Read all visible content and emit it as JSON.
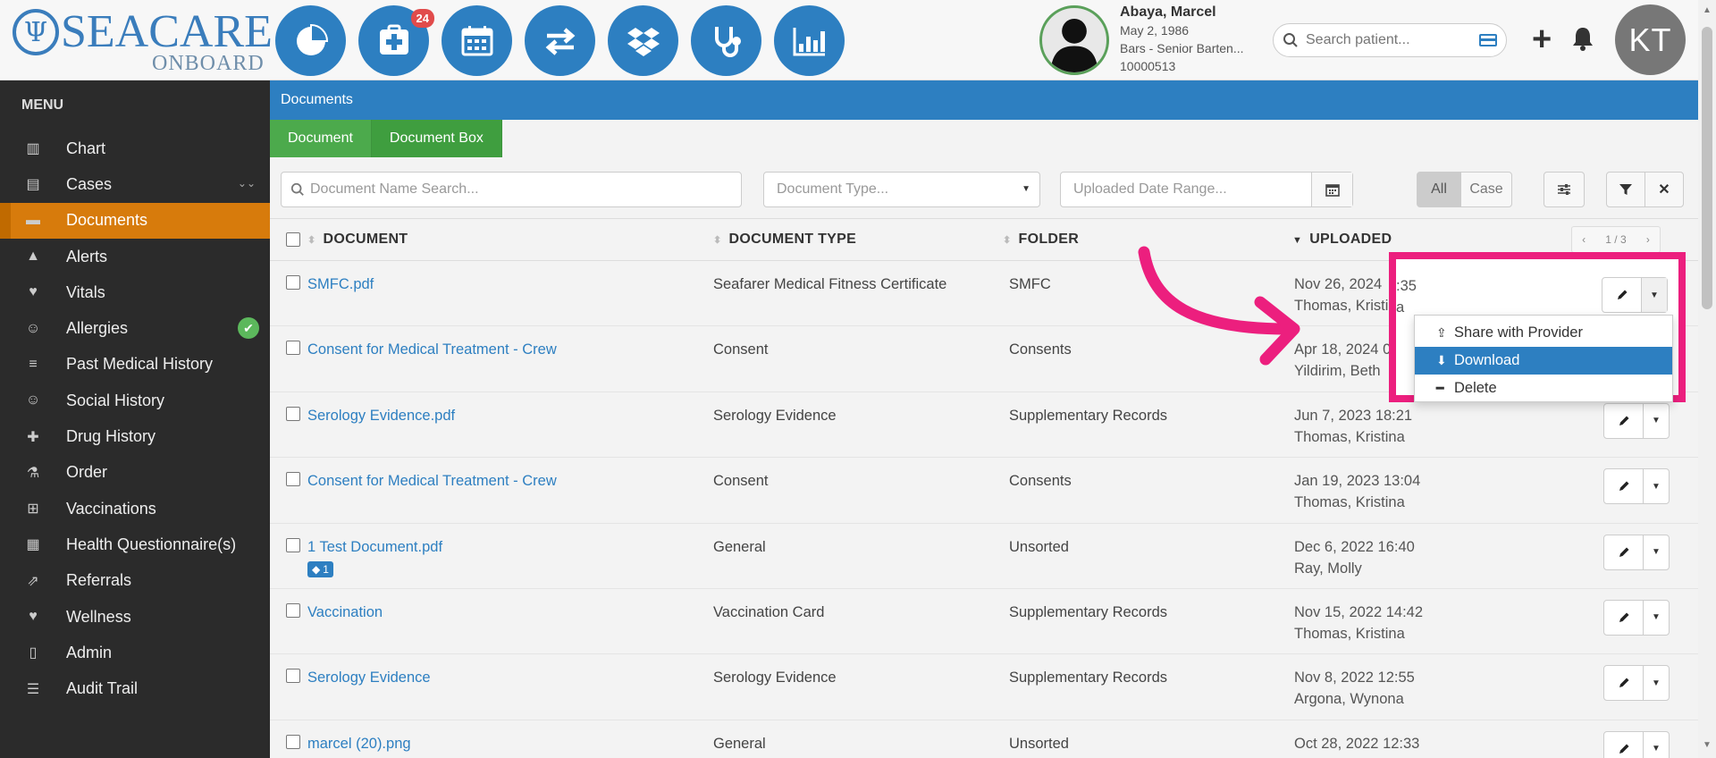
{
  "brand": {
    "name": "SEACARE",
    "sub": "ONBOARD"
  },
  "header": {
    "nav_badge": "24",
    "patient": {
      "name": "Abaya, Marcel",
      "dob": "May 2, 1986",
      "role": "Bars - Senior Barten...",
      "id": "10000513"
    },
    "search_placeholder": "Search patient...",
    "user_initials": "KT"
  },
  "sidebar": {
    "title": "MENU",
    "items": [
      {
        "label": "Chart",
        "icon": "bar-chart-icon"
      },
      {
        "label": "Cases",
        "icon": "archive-icon"
      },
      {
        "label": "Documents",
        "icon": "folder-icon"
      },
      {
        "label": "Alerts",
        "icon": "warning-icon"
      },
      {
        "label": "Vitals",
        "icon": "heart-icon"
      },
      {
        "label": "Allergies",
        "icon": "smile-icon"
      },
      {
        "label": "Past Medical History",
        "icon": "sort-icon"
      },
      {
        "label": "Social History",
        "icon": "smile-icon"
      },
      {
        "label": "Drug History",
        "icon": "medkit-icon"
      },
      {
        "label": "Order",
        "icon": "flask-icon"
      },
      {
        "label": "Vaccinations",
        "icon": "plus-square-icon"
      },
      {
        "label": "Health Questionnaire(s)",
        "icon": "form-icon"
      },
      {
        "label": "Referrals",
        "icon": "share-square-icon"
      },
      {
        "label": "Wellness",
        "icon": "heartbeat-icon"
      },
      {
        "label": "Admin",
        "icon": "file-icon"
      },
      {
        "label": "Audit Trail",
        "icon": "list-sort-icon"
      }
    ]
  },
  "page": {
    "title": "Documents",
    "tabs": [
      "Document",
      "Document Box"
    ],
    "filters": {
      "name_placeholder": "Document Name Search...",
      "type_placeholder": "Document Type...",
      "date_placeholder": "Uploaded Date Range...",
      "toggle_all": "All",
      "toggle_case": "Case"
    },
    "columns": [
      "DOCUMENT",
      "DOCUMENT TYPE",
      "FOLDER",
      "UPLOADED"
    ],
    "pager": "1 / 3",
    "rows": [
      {
        "doc": "SMFC.pdf",
        "type": "Seafarer Medical Fitness Certificate",
        "folder": "SMFC",
        "date": "Nov 26, 2024",
        "time_suffix": ":35",
        "user": "Thomas, Kristi",
        "user_suffix": "a"
      },
      {
        "doc": "Consent for Medical Treatment - Crew",
        "type": "Consent",
        "folder": "Consents",
        "date": "Apr 18, 2024 0",
        "user": "Yildirim, Beth"
      },
      {
        "doc": "Serology Evidence.pdf",
        "type": "Serology Evidence",
        "folder": "Supplementary Records",
        "date": "Jun 7, 2023 18:21",
        "user": "Thomas, Kristina"
      },
      {
        "doc": "Consent for Medical Treatment - Crew",
        "type": "Consent",
        "folder": "Consents",
        "date": "Jan 19, 2023 13:04",
        "user": "Thomas, Kristina"
      },
      {
        "doc": "1 Test Document.pdf",
        "tag": "1",
        "type": "General",
        "folder": "Unsorted",
        "date": "Dec 6, 2022 16:40",
        "user": "Ray, Molly"
      },
      {
        "doc": "Vaccination",
        "type": "Vaccination Card",
        "folder": "Supplementary Records",
        "date": "Nov 15, 2022 14:42",
        "user": "Thomas, Kristina"
      },
      {
        "doc": "Serology Evidence",
        "type": "Serology Evidence",
        "folder": "Supplementary Records",
        "date": "Nov 8, 2022 12:55",
        "user": "Argona, Wynona"
      },
      {
        "doc": "marcel (20).png",
        "type": "General",
        "folder": "Unsorted",
        "date": "Oct 28, 2022 12:33",
        "user": "Thomas, Kristina"
      }
    ],
    "dropdown": [
      "Share with Provider",
      "Download",
      "Delete"
    ]
  },
  "colors": {
    "primary": "#2d7fc1",
    "accent": "#d77b0c",
    "tab": "#4caa4c",
    "highlight": "#ec1f7e"
  }
}
